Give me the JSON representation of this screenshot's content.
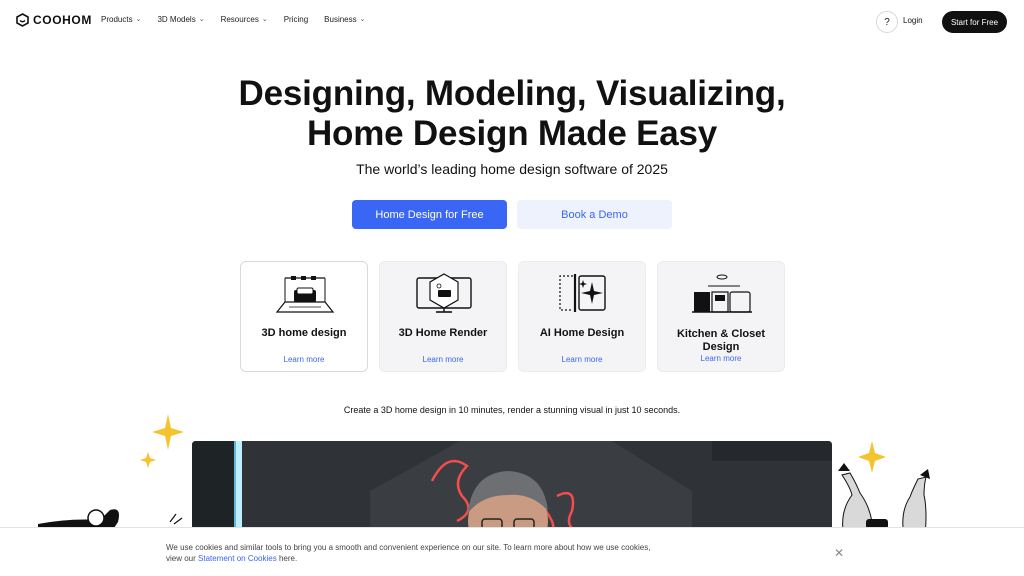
{
  "header": {
    "brand": "COOHOM",
    "nav": [
      {
        "label": "Products",
        "has_dropdown": true
      },
      {
        "label": "3D Models",
        "has_dropdown": true
      },
      {
        "label": "Resources",
        "has_dropdown": true
      },
      {
        "label": "Pricing",
        "has_dropdown": false
      },
      {
        "label": "Business",
        "has_dropdown": true
      }
    ],
    "help_label": "?",
    "login_label": "Login",
    "start_label": "Start for Free"
  },
  "hero": {
    "title_line1": "Designing, Modeling, Visualizing,",
    "title_line2": "Home Design Made Easy",
    "subtitle": "The world’s leading home design software of 2025",
    "primary_cta": "Home Design for Free",
    "secondary_cta": "Book a Demo"
  },
  "cards": [
    {
      "title": "3D home design",
      "link": "Learn more",
      "icon": "sofa-room-icon"
    },
    {
      "title": "3D Home Render",
      "link": "Learn more",
      "icon": "monitor-render-icon"
    },
    {
      "title": "AI Home Design",
      "link": "Learn more",
      "icon": "ai-sparkle-icon"
    },
    {
      "title": "Kitchen & Closet Design",
      "link": "Learn more",
      "icon": "kitchen-cabinet-icon"
    }
  ],
  "tagline": "Create a 3D home design in 10 minutes, render a stunning visual in just 10 seconds.",
  "cookie": {
    "text_before": "We use cookies and similar tools to bring you a smooth and convenient experience on our site. To learn more about how we use cookies, view our ",
    "link_text": "Statement on Cookies",
    "text_after": " here.",
    "close_symbol": "✕"
  },
  "colors": {
    "accent": "#3a66f5",
    "secondary_bg": "#edf2fd",
    "dark": "#111111",
    "star": "#f4c430"
  }
}
